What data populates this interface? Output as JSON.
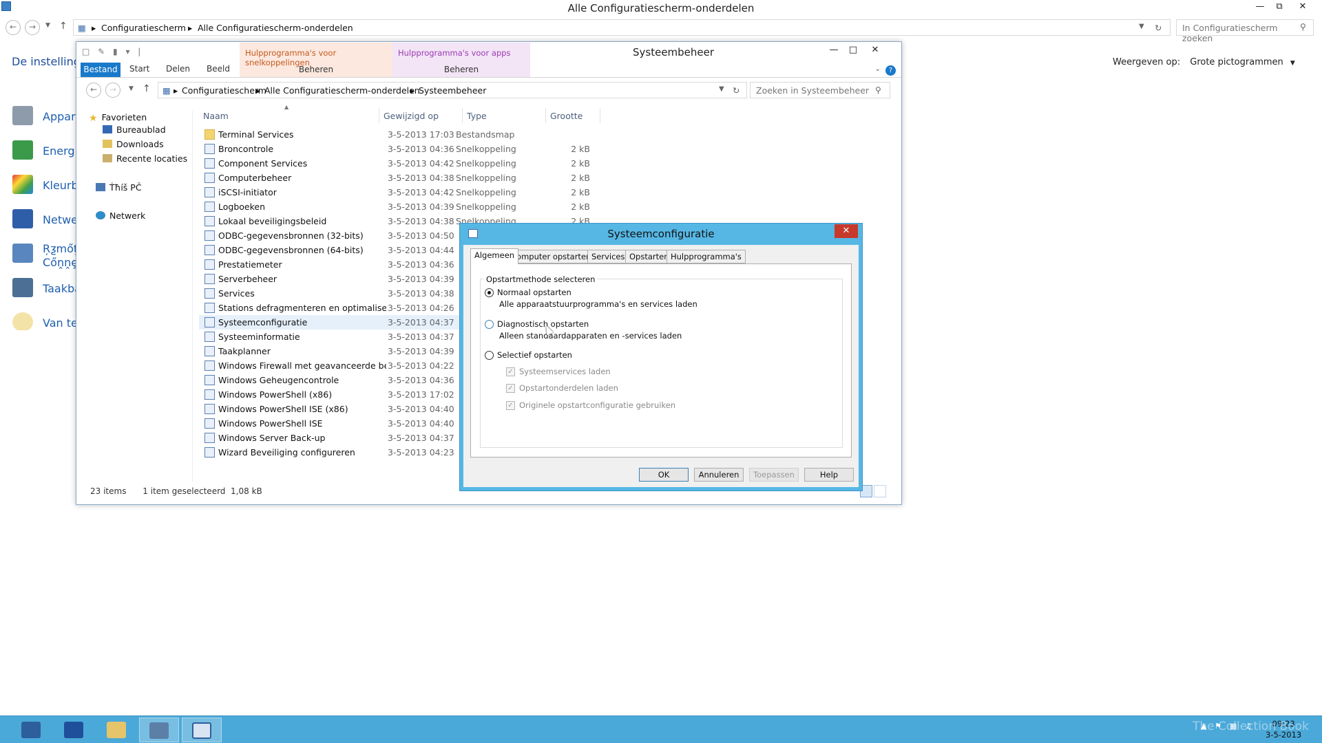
{
  "control_panel": {
    "title": "Alle Configuratiescherm-onderdelen",
    "breadcrumb": [
      "Configuratiescherm",
      "Alle Configuratiescherm-onderdelen"
    ],
    "search_placeholder": "In Configuratiescherm zoeken",
    "left_title": "De instellinge",
    "items": [
      {
        "label": "Appara",
        "icon": "device-manager-icon"
      },
      {
        "label": "Energie",
        "icon": "power-options-icon"
      },
      {
        "label": "Kleurbe",
        "icon": "color-management-icon"
      },
      {
        "label": "Netwer",
        "icon": "network-sharing-icon"
      },
      {
        "label": "Ŗƺmőţȩ Cőṋṋȩ",
        "icon": "remote-connection-icon"
      },
      {
        "label": "Taakba",
        "icon": "taskbar-icon"
      },
      {
        "label": "Van tek",
        "icon": "speech-icon"
      }
    ],
    "view_by_label": "Weergeven op:",
    "view_by_value": "Grote pictogrammen"
  },
  "explorer": {
    "title": "Systeembeheer",
    "ribbon_tabs": [
      "Bestand",
      "Start",
      "Delen",
      "Beeld"
    ],
    "context_tabs": [
      {
        "label": "Hulpprogramma's voor snelkoppelingen",
        "sub": "Beheren"
      },
      {
        "label": "Hulpprogramma's voor apps",
        "sub": "Beheren"
      }
    ],
    "breadcrumb": [
      "Configuratiescherm",
      "Alle Configuratiescherm-onderdelen",
      "Systeembeheer"
    ],
    "search_placeholder": "Zoeken in Systeembeheer",
    "nav": {
      "favorites": "Favorieten",
      "fav_items": [
        "Bureaublad",
        "Downloads",
        "Recente locaties"
      ],
      "this_pc": "Ṫħíš PČ",
      "network": "Netwerk"
    },
    "columns": [
      "Naam",
      "Gewijzigd op",
      "Type",
      "Grootte"
    ],
    "files": [
      {
        "name": "Terminal Services",
        "date": "3-5-2013 17:03",
        "type": "Bestandsmap",
        "size": "",
        "folder": true
      },
      {
        "name": "Broncontrole",
        "date": "3-5-2013 04:36",
        "type": "Snelkoppeling",
        "size": "2 kB"
      },
      {
        "name": "Component Services",
        "date": "3-5-2013 04:42",
        "type": "Snelkoppeling",
        "size": "2 kB"
      },
      {
        "name": "Computerbeheer",
        "date": "3-5-2013 04:38",
        "type": "Snelkoppeling",
        "size": "2 kB"
      },
      {
        "name": "iSCSI-initiator",
        "date": "3-5-2013 04:42",
        "type": "Snelkoppeling",
        "size": "2 kB"
      },
      {
        "name": "Logboeken",
        "date": "3-5-2013 04:39",
        "type": "Snelkoppeling",
        "size": "2 kB"
      },
      {
        "name": "Lokaal beveiligingsbeleid",
        "date": "3-5-2013 04:38",
        "type": "Snelkoppeling",
        "size": "2 kB"
      },
      {
        "name": "ODBC-gegevensbronnen (32-bits)",
        "date": "3-5-2013 04:50",
        "type": "",
        "size": ""
      },
      {
        "name": "ODBC-gegevensbronnen (64-bits)",
        "date": "3-5-2013 04:44",
        "type": "",
        "size": ""
      },
      {
        "name": "Prestatiemeter",
        "date": "3-5-2013 04:36",
        "type": "",
        "size": ""
      },
      {
        "name": "Serverbeheer",
        "date": "3-5-2013 04:39",
        "type": "",
        "size": ""
      },
      {
        "name": "Services",
        "date": "3-5-2013 04:38",
        "type": "",
        "size": ""
      },
      {
        "name": "Stations defragmenteren en optimaliseren",
        "date": "3-5-2013 04:26",
        "type": "",
        "size": ""
      },
      {
        "name": "Systeemconfiguratie",
        "date": "3-5-2013 04:37",
        "type": "",
        "size": "",
        "selected": true
      },
      {
        "name": "Systeeminformatie",
        "date": "3-5-2013 04:37",
        "type": "",
        "size": ""
      },
      {
        "name": "Taakplanner",
        "date": "3-5-2013 04:39",
        "type": "",
        "size": ""
      },
      {
        "name": "Windows Firewall met geavanceerde bev...",
        "date": "3-5-2013 04:22",
        "type": "",
        "size": ""
      },
      {
        "name": "Windows Geheugencontrole",
        "date": "3-5-2013 04:36",
        "type": "",
        "size": ""
      },
      {
        "name": "Windows PowerShell (x86)",
        "date": "3-5-2013 17:02",
        "type": "",
        "size": ""
      },
      {
        "name": "Windows PowerShell ISE (x86)",
        "date": "3-5-2013 04:40",
        "type": "",
        "size": ""
      },
      {
        "name": "Windows PowerShell ISE",
        "date": "3-5-2013 04:40",
        "type": "",
        "size": ""
      },
      {
        "name": "Windows Server Back-up",
        "date": "3-5-2013 04:37",
        "type": "",
        "size": ""
      },
      {
        "name": "Wizard Beveiliging configureren",
        "date": "3-5-2013 04:23",
        "type": "",
        "size": ""
      }
    ],
    "status_items": "23 items",
    "status_selected": "1 item geselecteerd  1,08 kB"
  },
  "dialog": {
    "title": "Systeemconfiguratie",
    "tabs": [
      "Algemeen",
      "Computer opstarten",
      "Services",
      "Opstarten",
      "Hulpprogramma's"
    ],
    "active_tab": "Algemeen",
    "group_title": "Opstartmethode selecteren",
    "options": [
      {
        "label": "Normaal opstarten",
        "desc": "Alle apparaatstuurprogramma's en services laden",
        "checked": true
      },
      {
        "label": "Diagnostisch opstarten",
        "desc": "Alleen standaardapparaten en -services laden",
        "checked": false
      },
      {
        "label": "Selectief opstarten",
        "desc": "",
        "checked": false
      }
    ],
    "checkboxes": [
      "Systeemservices laden",
      "Opstartonderdelen laden",
      "Originele opstartconfiguratie gebruiken"
    ],
    "buttons": {
      "ok": "OK",
      "cancel": "Annuleren",
      "apply": "Toepassen",
      "help": "Help"
    }
  },
  "taskbar": {
    "apps": [
      "server-manager-icon",
      "powershell-icon",
      "file-explorer-icon",
      "control-panel-icon",
      "system-config-icon"
    ],
    "watermark": "The Collection Book",
    "clock_time": "09:23",
    "clock_date": "3-5-2013"
  },
  "colors": {
    "accent": "#1979ca",
    "dialog_frame": "#56b7e4",
    "taskbar": "#4ba9d9",
    "close_red": "#c7392b",
    "selection": "#e5f0fb"
  }
}
